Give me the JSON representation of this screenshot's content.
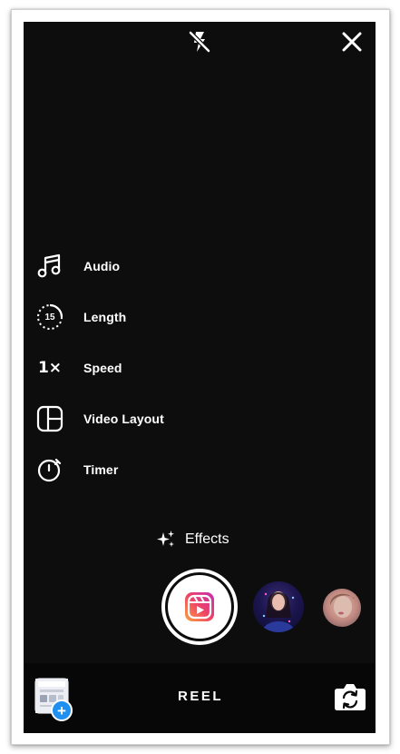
{
  "camera": {
    "flash": {
      "icon": "flash-off-icon"
    },
    "close": {
      "icon": "close-icon"
    }
  },
  "tools": [
    {
      "label": "Audio",
      "icon": "music-note-icon"
    },
    {
      "label": "Length",
      "icon": "length-timer-icon",
      "value": "15"
    },
    {
      "label": "Speed",
      "icon": "speed-icon",
      "value": "1×"
    },
    {
      "label": "Video Layout",
      "icon": "video-layout-icon"
    },
    {
      "label": "Timer",
      "icon": "timer-icon"
    }
  ],
  "effects": {
    "label": "Effects",
    "icon": "sparkles-icon"
  },
  "capture": {
    "icon": "reels-logo-icon"
  },
  "bottom": {
    "mode_label": "REEL",
    "gallery_plus": "+",
    "flip_icon": "flip-camera-icon"
  },
  "colors": {
    "background": "#0d0d0d",
    "accent_blue": "#1f8ff0",
    "reel_gradient": [
      "#f9a43c",
      "#ef4367",
      "#c32fb1"
    ]
  }
}
